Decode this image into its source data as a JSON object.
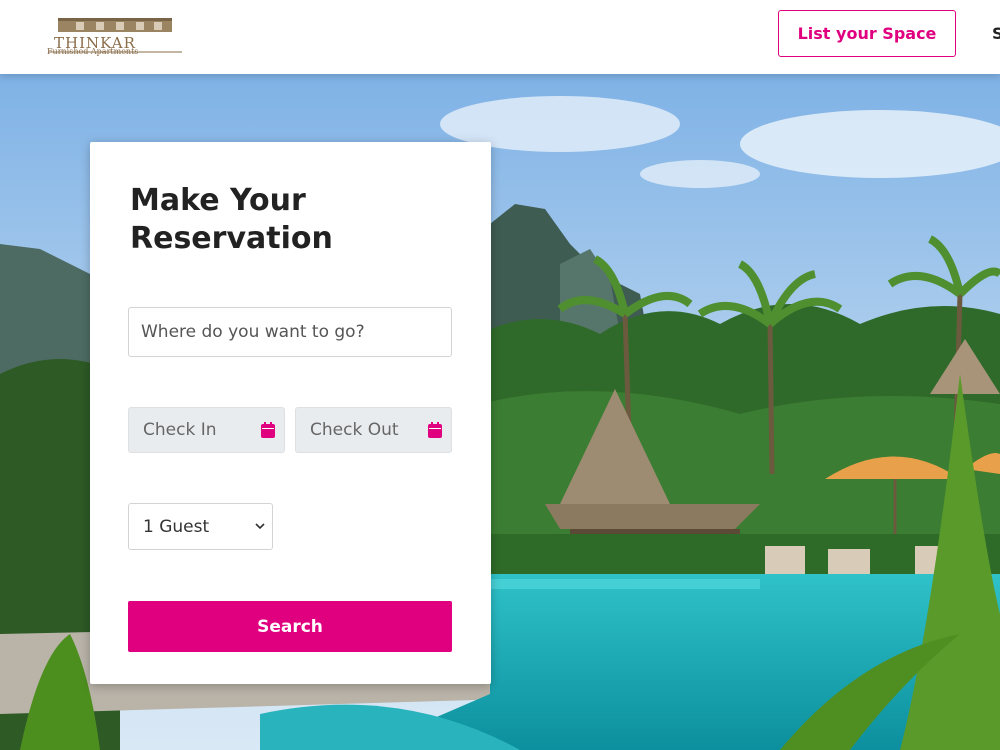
{
  "header": {
    "logo_name": "THINKAR",
    "logo_tagline": "Furnished Apartments",
    "list_button": "List your Space",
    "nav_partial": "S"
  },
  "reservation": {
    "title": "Make Your Reservation",
    "destination_placeholder": "Where do you want to go?",
    "check_in": "Check In",
    "check_out": "Check Out",
    "guests_selected": "1 Guest",
    "search_button": "Search"
  },
  "colors": {
    "accent": "#e0007f",
    "logo": "#8a6d4a",
    "date_bg": "#e9ecef"
  },
  "icons": {
    "calendar": "calendar-icon",
    "chevron": "chevron-down-icon"
  }
}
